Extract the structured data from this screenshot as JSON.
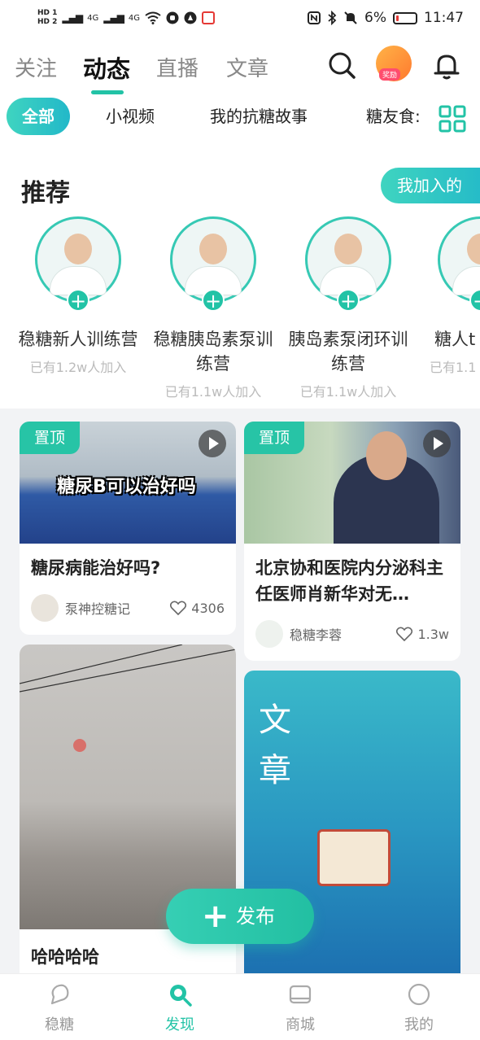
{
  "status_bar": {
    "hd1": "HD 1",
    "hd2": "HD 2",
    "sig1": "4G",
    "sig2": "4G",
    "battery": "6%",
    "time": "11:47"
  },
  "top_tabs": [
    {
      "label": "关注"
    },
    {
      "label": "动态"
    },
    {
      "label": "直播"
    },
    {
      "label": "文章"
    }
  ],
  "avatar_badge": "奖励",
  "chips": [
    {
      "label": "全部"
    },
    {
      "label": "小视频"
    },
    {
      "label": "我的抗糖故事"
    },
    {
      "label": "糖友食:"
    }
  ],
  "recommend": {
    "title": "推荐",
    "joined_button": "我加入的",
    "camps": [
      {
        "name": "稳糖新人训练营",
        "joined": "已有1.2w人加入"
      },
      {
        "name": "稳糖胰岛素泵训练营",
        "joined": "已有1.1w人加入"
      },
      {
        "name": "胰岛素泵闭环训练营",
        "joined": "已有1.1w人加入"
      },
      {
        "name": "糖人t",
        "joined": "已有1.1"
      }
    ]
  },
  "feed": [
    {
      "pin": "置顶",
      "caption": "糖尿B可以治好吗",
      "title": "糖尿病能治好吗?",
      "author": "泵神控糖记",
      "likes": "4306"
    },
    {
      "pin": "置顶",
      "title": "北京协和医院内分泌科主任医师肖新华对无…",
      "author": "稳糖李蓉",
      "likes": "1.3w"
    },
    {
      "title": "哈哈哈哈"
    },
    {
      "vertical_text": "文章"
    }
  ],
  "fab": {
    "label": "发布"
  },
  "bottom_nav": [
    {
      "label": "稳糖"
    },
    {
      "label": "发现"
    },
    {
      "label": "商城"
    },
    {
      "label": "我的"
    }
  ],
  "colors": {
    "accent": "#22c3a6",
    "accent_gradient_end": "#22b8c9"
  }
}
